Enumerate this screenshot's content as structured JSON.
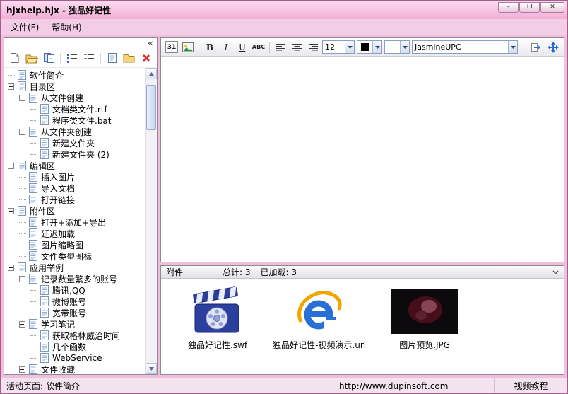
{
  "window": {
    "title": "hjxhelp.hjx - 独品好记性",
    "minimize_glyph": "–",
    "maximize_glyph": "❐",
    "close_glyph": "✕"
  },
  "menu_bar": {
    "file": "文件(F)",
    "help": "帮助(H)"
  },
  "left_panel": {
    "collapse_glyph": "«",
    "toolbar_icons": [
      "new-document-icon",
      "open-folder-icon",
      "copy-pages-icon",
      "ordered-list-icon",
      "detail-list-icon",
      "save-page-icon",
      "folder-icon",
      "delete-icon"
    ]
  },
  "tree": {
    "items": [
      {
        "label": "软件简介",
        "depth": 0,
        "parent": false
      },
      {
        "label": "目录区",
        "depth": 0,
        "parent": true
      },
      {
        "label": "从文件创建",
        "depth": 1,
        "parent": true
      },
      {
        "label": "文档类文件.rtf",
        "depth": 2,
        "parent": false
      },
      {
        "label": "程序类文件.bat",
        "depth": 2,
        "parent": false
      },
      {
        "label": "从文件夹创建",
        "depth": 1,
        "parent": true
      },
      {
        "label": "新建文件夹",
        "depth": 2,
        "parent": false
      },
      {
        "label": "新建文件夹 (2)",
        "depth": 2,
        "parent": false
      },
      {
        "label": "编辑区",
        "depth": 0,
        "parent": true
      },
      {
        "label": "插入图片",
        "depth": 1,
        "parent": false
      },
      {
        "label": "导入文档",
        "depth": 1,
        "parent": false
      },
      {
        "label": "打开链接",
        "depth": 1,
        "parent": false
      },
      {
        "label": "附件区",
        "depth": 0,
        "parent": true
      },
      {
        "label": "打开+添加+导出",
        "depth": 1,
        "parent": false
      },
      {
        "label": "延迟加载",
        "depth": 1,
        "parent": false
      },
      {
        "label": "图片缩略图",
        "depth": 1,
        "parent": false
      },
      {
        "label": "文件类型图标",
        "depth": 1,
        "parent": false
      },
      {
        "label": "应用举例",
        "depth": 0,
        "parent": true
      },
      {
        "label": "记录数量繁多的账号",
        "depth": 1,
        "parent": true
      },
      {
        "label": "腾讯,QQ",
        "depth": 2,
        "parent": false
      },
      {
        "label": "微博账号",
        "depth": 2,
        "parent": false
      },
      {
        "label": "宽带账号",
        "depth": 2,
        "parent": false
      },
      {
        "label": "学习笔记",
        "depth": 1,
        "parent": true
      },
      {
        "label": "获取格林威治时间",
        "depth": 2,
        "parent": false
      },
      {
        "label": "几个函数",
        "depth": 2,
        "parent": false
      },
      {
        "label": "WebService",
        "depth": 2,
        "parent": false
      },
      {
        "label": "文件收藏",
        "depth": 1,
        "parent": true
      }
    ]
  },
  "editor_toolbar": {
    "calendar": "31",
    "bold": "B",
    "italic": "I",
    "underline": "U",
    "strikethrough": "ABC",
    "font_size": "12",
    "font_color": "#000000",
    "font_name": "JasmineUPC",
    "icons": [
      "insert-date-icon",
      "insert-image-icon",
      "align-left-icon",
      "align-center-icon",
      "align-right-icon",
      "export-icon",
      "fit-window-icon"
    ]
  },
  "attachments": {
    "title": "附件",
    "total": "总计: 3",
    "loaded": "已加载: 3",
    "items": [
      {
        "label": "独品好记性.swf",
        "icon": "movie-clapperboard-icon"
      },
      {
        "label": "独品好记性-视频演示.url",
        "icon": "internet-explorer-icon"
      },
      {
        "label": "图片预览.JPG",
        "icon": "photo-thumbnail"
      }
    ]
  },
  "status_bar": {
    "active_page": "活动页面: 软件简介",
    "url": "http://www.dupinsoft.com",
    "video_link": "视频教程"
  }
}
